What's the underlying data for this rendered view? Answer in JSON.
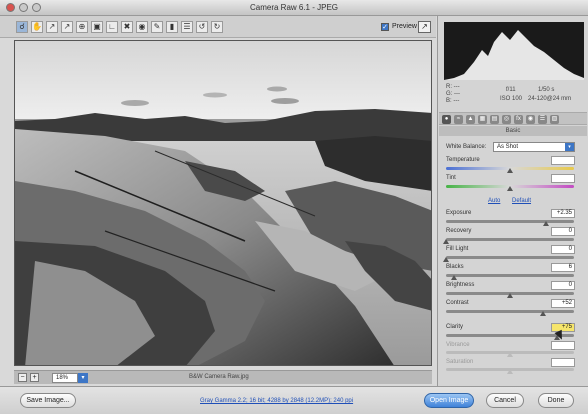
{
  "window": {
    "title": "Camera Raw 6.1 - JPEG"
  },
  "toolbar": {
    "tools": [
      "zoom-tool",
      "hand-tool",
      "white-balance-tool",
      "color-sampler-tool",
      "targeted-adjustment-tool",
      "crop-tool",
      "straighten-tool",
      "spot-removal-tool",
      "red-eye-tool",
      "adjustment-brush-tool",
      "graduated-filter-tool",
      "preferences-tool",
      "rotate-left-tool",
      "rotate-right-tool"
    ],
    "preview_label": "Preview",
    "preview_checked": true
  },
  "image": {
    "filename": "B&W Camera Raw.jpg"
  },
  "zoom": {
    "value": "18%"
  },
  "histogram": {
    "rgb": {
      "r": "R: ---",
      "g": "G: ---",
      "b": "B: ---"
    },
    "exif": {
      "aperture": "f/11",
      "shutter": "1/50 s",
      "iso": "ISO 100",
      "lens": "24-120@24 mm"
    }
  },
  "panel": {
    "section_title": "Basic",
    "white_balance": {
      "label": "White Balance:",
      "value": "As Shot"
    },
    "auto_label": "Auto",
    "default_label": "Default",
    "sliders": [
      {
        "label": "Temperature",
        "value": "",
        "pos": 0.5
      },
      {
        "label": "Tint",
        "value": "",
        "pos": 0.5
      },
      {
        "label": "Exposure",
        "value": "+2.35",
        "pos": 0.78
      },
      {
        "label": "Recovery",
        "value": "0",
        "pos": 0.0
      },
      {
        "label": "Fill Light",
        "value": "0",
        "pos": 0.0
      },
      {
        "label": "Blacks",
        "value": "6",
        "pos": 0.06
      },
      {
        "label": "Brightness",
        "value": "0",
        "pos": 0.5
      },
      {
        "label": "Contrast",
        "value": "+52",
        "pos": 0.76
      },
      {
        "label": "Clarity",
        "value": "+75",
        "pos": 0.87
      },
      {
        "label": "Vibrance",
        "value": "",
        "pos": 0.5
      },
      {
        "label": "Saturation",
        "value": "",
        "pos": 0.5
      }
    ]
  },
  "footer": {
    "save_label": "Save Image...",
    "workflow_text": "Gray Gamma 2.2; 16 bit; 4288 by 2848 (12.2MP); 240 ppi",
    "open_label": "Open Image",
    "cancel_label": "Cancel",
    "done_label": "Done"
  }
}
